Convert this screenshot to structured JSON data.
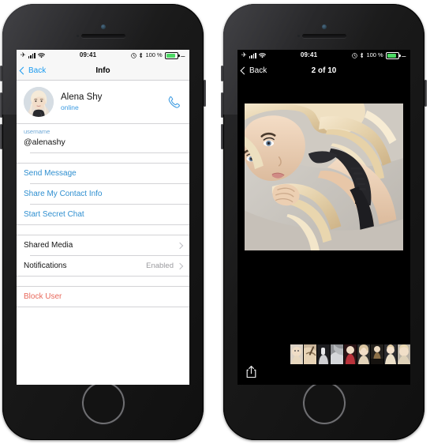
{
  "status_bar": {
    "airplane_icon": "airplane-icon",
    "signal_icon": "signal-bars-icon",
    "wifi_icon": "wifi-icon",
    "time": "09:41",
    "alarm_icon": "alarm-icon",
    "bluetooth_icon": "bluetooth-icon",
    "battery_percent": "100 %",
    "battery_icon": "battery-icon",
    "charging_icon": "charging-plug-icon"
  },
  "left_phone": {
    "navbar": {
      "back_label": "Back",
      "title": "Info"
    },
    "profile": {
      "name": "Alena Shy",
      "status": "online",
      "call_icon": "phone-call-icon",
      "avatar_icon": "avatar"
    },
    "username_field": {
      "label": "username",
      "value": "@alenashy"
    },
    "actions": [
      {
        "label": "Send Message",
        "style": "action"
      },
      {
        "label": "Share My Contact Info",
        "style": "action"
      },
      {
        "label": "Start Secret Chat",
        "style": "action"
      }
    ],
    "settings": [
      {
        "label": "Shared Media",
        "value": "",
        "style": "plain",
        "disclosure": true
      },
      {
        "label": "Notifications",
        "value": "Enabled",
        "style": "plain",
        "disclosure": true
      }
    ],
    "danger": [
      {
        "label": "Block User",
        "style": "danger"
      }
    ]
  },
  "right_phone": {
    "navbar": {
      "back_label": "Back",
      "title": "2 of 10"
    },
    "photo": {
      "index": 2,
      "total": 10,
      "alt": "portrait-photo"
    },
    "share_icon": "share-icon",
    "thumbnail_count": 9
  },
  "colors": {
    "accent_blue": "#3b9ae1",
    "link_blue": "#2f8fd0",
    "danger_red": "#e8695c",
    "battery_green": "#4cd964",
    "nav_light_bg": "#f7f7f7",
    "separator": "#d3d3d6"
  }
}
